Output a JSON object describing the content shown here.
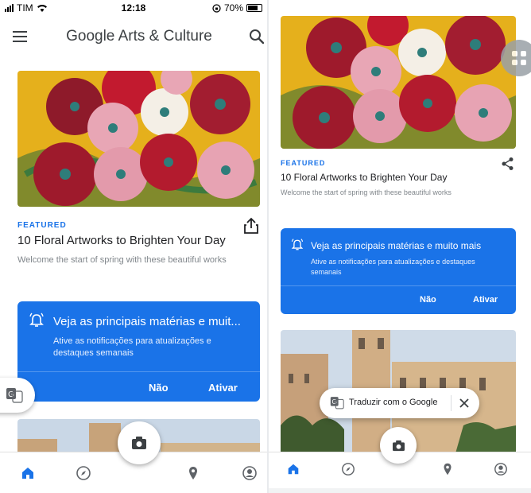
{
  "status_bar": {
    "carrier": "TIM",
    "time": "12:18",
    "battery": "70%"
  },
  "app_title": "Google Arts & Culture",
  "article": {
    "label": "FEATURED",
    "title": "10 Floral Artworks to Brighten Your Day",
    "subtitle": "Welcome the start of spring with these beautiful works"
  },
  "notification_card_left": {
    "title": "Veja as principais matérias e muit...",
    "body": "Ative as notificações para atualizações e destaques semanais",
    "no_label": "Não",
    "yes_label": "Ativar"
  },
  "notification_card_right": {
    "title": "Veja as principais matérias e muito mais",
    "body": "Ative as notificações para atualizações e destaques semanais",
    "no_label": "Não",
    "yes_label": "Ativar"
  },
  "translate_banner": {
    "label": "Traduzir com o Google"
  },
  "bottom_nav": [
    "home-icon",
    "explore-compass-icon",
    "camera-icon",
    "location-pin-icon",
    "profile-icon"
  ],
  "colors": {
    "accent": "#1a73e8",
    "hero_background": "#e8b31a"
  }
}
